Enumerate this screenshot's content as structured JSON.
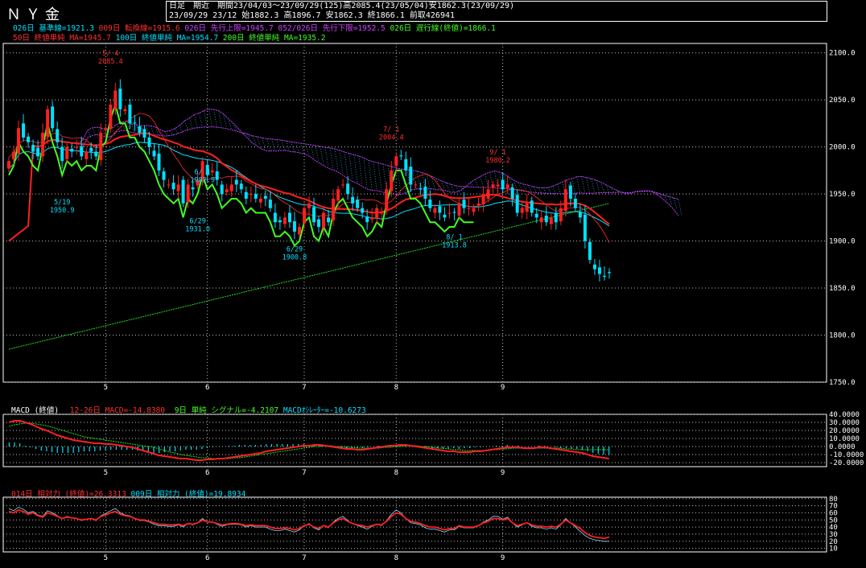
{
  "header": {
    "title": "ＮＹ金",
    "line1": "日足　期近　期間23/04/03～23/09/29(125)高2085.4(23/05/04)安1862.3(23/09/29)",
    "line2": "23/09/29 23/12 始1882.3 高1896.7 安1862.3 終1866.1 前取426941"
  },
  "legend_main": {
    "ich_kijun": "026日 基準線=1921.3",
    "ich_tenkan": "009日 転換線=1915.6",
    "ich_spanA": "026日 先行上限=1945.7",
    "ich_spanB": "052/026日 先行下限=1952.5",
    "ich_chikou": "026日 遅行線(終値)=1866.1",
    "ma50": "50日 終値単純 MA=1945.7",
    "ma100": "100日 終値単純 MA=1954.7",
    "ma200": "200日 終値単純 MA=1935.2"
  },
  "legend_macd": {
    "title": "MACD (終値)",
    "macd": "12-26日 MACD=-14.8380",
    "signal": "9日 単純 シグナル=-4.2107",
    "osc": "MACDｵｼﾚｰﾀｰ=-10.6273"
  },
  "legend_rsi": {
    "rsi14": "014日 相対力 (終値)=26.3313",
    "rsi9": "009日 相対力 (終値)=19.8934"
  },
  "colors": {
    "up": "#ff2020",
    "down": "#00e0ff",
    "ma50": "#ff2020",
    "ma100": "#00e0ff",
    "ma200": "#20e020",
    "chikou": "#40ff20",
    "cloud": "#c040ff",
    "grid": "#c0c0c0"
  },
  "chart_data": [
    {
      "type": "candlestick",
      "name": "price",
      "y_ticks": [
        "2100.0",
        "2050.0",
        "2000.0",
        "1950.0",
        "1900.0",
        "1850.0",
        "1800.0",
        "1750.0"
      ],
      "ylim": [
        1750,
        2110
      ],
      "x_ticks": [
        "5",
        "6",
        "7",
        "8",
        "9"
      ],
      "x_tick_index": [
        20,
        41,
        61,
        80,
        102
      ],
      "n_bars": 125,
      "closes": [
        1985,
        1995,
        2020,
        2010,
        2005,
        1995,
        1990,
        2015,
        2040,
        2020,
        2005,
        1985,
        2000,
        1995,
        2000,
        1990,
        1995,
        1995,
        1990,
        2015,
        2020,
        2045,
        2060,
        2040,
        2040,
        2025,
        2025,
        2015,
        2010,
        2000,
        1990,
        1975,
        1965,
        1960,
        1955,
        1960,
        1940,
        1960,
        1955,
        1965,
        1985,
        1970,
        1975,
        1965,
        1950,
        1955,
        1960,
        1960,
        1955,
        1945,
        1950,
        1945,
        1945,
        1945,
        1935,
        1920,
        1920,
        1925,
        1920,
        1910,
        1915,
        1935,
        1940,
        1920,
        1915,
        1930,
        1920,
        1945,
        1955,
        1960,
        1950,
        1940,
        1935,
        1930,
        1920,
        1925,
        1935,
        1930,
        1955,
        1975,
        1990,
        1990,
        1975,
        1960,
        1960,
        1955,
        1945,
        1935,
        1935,
        1930,
        1925,
        1930,
        1930,
        1940,
        1935,
        1935,
        1935,
        1940,
        1950,
        1955,
        1960,
        1960,
        1955,
        1960,
        1945,
        1930,
        1935,
        1940,
        1930,
        1925,
        1925,
        1920,
        1925,
        1920,
        1935,
        1955,
        1945,
        1935,
        1925,
        1900,
        1880,
        1870,
        1865,
        1862,
        1866
      ],
      "annotations": [
        {
          "label": "5/ 4",
          "value": "2085.4",
          "i": 21
        },
        {
          "label": "5/19",
          "value": "1950.9",
          "i": 11
        },
        {
          "label": "6/ 1",
          "value": "1982.9",
          "i": 40
        },
        {
          "label": "6/29",
          "value": "1931.0",
          "i": 39
        },
        {
          "label": "6/29",
          "value": "1900.8",
          "i": 59
        },
        {
          "label": "7/ 1",
          "value": "2004.4",
          "i": 79
        },
        {
          "label": "8/ 1",
          "value": "1913.8",
          "i": 92
        },
        {
          "label": "9/ 1",
          "value": "1980.2",
          "i": 101
        }
      ]
    },
    {
      "type": "line",
      "name": "macd",
      "y_ticks": [
        "40.0000",
        "30.0000",
        "20.0000",
        "10.0000",
        "0.0000",
        "-10.0000",
        "-20.0000"
      ],
      "ylim": [
        -25,
        40
      ],
      "macd": [
        30,
        32,
        32,
        30,
        28,
        25,
        22,
        20,
        17,
        14,
        12,
        10,
        8,
        7,
        6,
        5,
        4,
        4,
        3,
        3,
        2,
        1,
        0,
        -1,
        -3,
        -5,
        -7,
        -9,
        -11,
        -12,
        -13,
        -14,
        -15,
        -15,
        -16,
        -17,
        -17,
        -16,
        -16,
        -15,
        -15,
        -14,
        -13,
        -12,
        -11,
        -10,
        -9,
        -8,
        -6,
        -5,
        -4,
        -3,
        -2,
        -1,
        0,
        1,
        1,
        2,
        2,
        1,
        0,
        -1,
        -2,
        -3,
        -3,
        -4,
        -4,
        -3,
        -2,
        -1,
        0,
        1,
        1,
        2,
        2,
        1,
        0,
        -1,
        -2,
        -3,
        -4,
        -5,
        -6,
        -6,
        -7,
        -7,
        -7,
        -6,
        -6,
        -5,
        -4,
        -3,
        -2,
        -1,
        -1,
        -1,
        -2,
        -2,
        -2,
        -1,
        -1,
        -2,
        -3,
        -4,
        -5,
        -6,
        -7,
        -8,
        -10,
        -12,
        -13,
        -14,
        -15
      ],
      "signal": [
        25,
        27,
        28,
        29,
        29,
        28,
        27,
        26,
        24,
        22,
        20,
        18,
        16,
        14,
        12,
        11,
        10,
        9,
        8,
        7,
        6,
        5,
        4,
        3,
        2,
        1,
        0,
        -1,
        -3,
        -5,
        -7,
        -8,
        -10,
        -11,
        -12,
        -13,
        -14,
        -14,
        -15,
        -15,
        -15,
        -15,
        -14,
        -14,
        -13,
        -12,
        -11,
        -10,
        -9,
        -8,
        -7,
        -6,
        -5,
        -4,
        -3,
        -2,
        -1,
        0,
        0,
        1,
        1,
        0,
        0,
        -1,
        -1,
        -2,
        -2,
        -2,
        -2,
        -2,
        -1,
        -1,
        0,
        0,
        1,
        1,
        1,
        0,
        0,
        -1,
        -2,
        -2,
        -3,
        -4,
        -4,
        -5,
        -5,
        -5,
        -5,
        -5,
        -4,
        -4,
        -3,
        -3,
        -2,
        -2,
        -2,
        -2,
        -2,
        -2,
        -2,
        -2,
        -2,
        -2,
        -3,
        -3,
        -4,
        -4,
        -4,
        -4,
        -4,
        -4,
        -4
      ]
    },
    {
      "type": "line",
      "name": "rsi",
      "y_ticks": [
        "80",
        "70",
        "60",
        "50",
        "40",
        "30",
        "20",
        "10"
      ],
      "ylim": [
        5,
        82
      ],
      "rsi14": [
        62,
        60,
        64,
        62,
        58,
        60,
        56,
        54,
        60,
        58,
        55,
        52,
        54,
        53,
        52,
        50,
        51,
        52,
        50,
        55,
        57,
        60,
        62,
        58,
        56,
        55,
        52,
        50,
        50,
        48,
        46,
        44,
        44,
        43,
        43,
        44,
        42,
        45,
        44,
        46,
        50,
        47,
        47,
        45,
        43,
        44,
        45,
        45,
        44,
        42,
        43,
        42,
        42,
        42,
        40,
        38,
        38,
        39,
        38,
        36,
        38,
        42,
        44,
        40,
        38,
        42,
        40,
        46,
        50,
        52,
        48,
        45,
        43,
        42,
        40,
        42,
        44,
        43,
        48,
        55,
        60,
        58,
        52,
        48,
        47,
        45,
        42,
        40,
        40,
        38,
        36,
        38,
        38,
        42,
        40,
        40,
        40,
        42,
        46,
        48,
        52,
        52,
        50,
        52,
        46,
        42,
        44,
        46,
        43,
        41,
        41,
        40,
        41,
        40,
        44,
        50,
        46,
        42,
        38,
        32,
        28,
        26,
        25,
        24,
        26
      ],
      "rsi9": [
        66,
        63,
        68,
        65,
        60,
        62,
        57,
        55,
        63,
        60,
        56,
        52,
        55,
        53,
        52,
        49,
        51,
        52,
        49,
        56,
        59,
        63,
        66,
        60,
        57,
        56,
        52,
        49,
        49,
        47,
        44,
        42,
        42,
        41,
        41,
        43,
        40,
        45,
        43,
        46,
        52,
        47,
        47,
        44,
        41,
        43,
        44,
        44,
        43,
        40,
        42,
        40,
        40,
        40,
        37,
        35,
        35,
        37,
        35,
        33,
        36,
        42,
        45,
        39,
        36,
        42,
        39,
        47,
        52,
        55,
        49,
        45,
        42,
        40,
        37,
        41,
        44,
        42,
        49,
        58,
        64,
        60,
        52,
        46,
        45,
        43,
        39,
        37,
        37,
        35,
        33,
        36,
        36,
        41,
        39,
        39,
        39,
        42,
        47,
        50,
        55,
        55,
        51,
        54,
        46,
        40,
        43,
        46,
        41,
        39,
        39,
        37,
        39,
        37,
        43,
        52,
        46,
        40,
        34,
        28,
        24,
        22,
        21,
        20,
        20
      ]
    }
  ]
}
